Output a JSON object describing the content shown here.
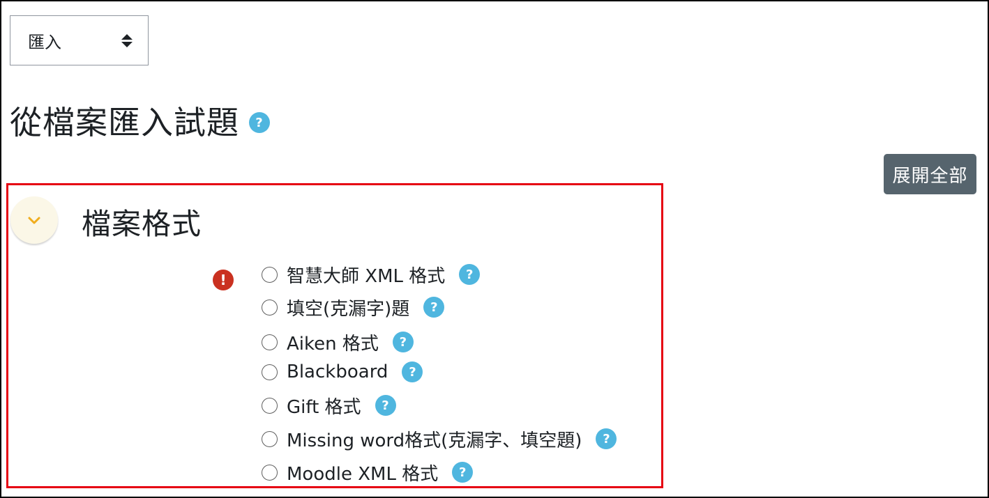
{
  "action_select": {
    "value": "匯入"
  },
  "page": {
    "title": "從檔案匯入試題"
  },
  "toolbar": {
    "expand_all_label": "展開全部"
  },
  "section": {
    "title": "檔案格式",
    "error_icon": "!",
    "options": [
      {
        "label": "智慧大師 XML 格式"
      },
      {
        "label": "填空(克漏字)題"
      },
      {
        "label": "Aiken 格式"
      },
      {
        "label": "Blackboard"
      },
      {
        "label": "Gift 格式"
      },
      {
        "label": "Missing word格式(克漏字、填空題)"
      },
      {
        "label": "Moodle XML 格式"
      }
    ]
  },
  "help_icon_glyph": "?",
  "colors": {
    "help": "#4fb6df",
    "error": "#ca3120",
    "accent_toggle": "#f0ad1e",
    "highlight_box": "#e60012",
    "button": "#56646d"
  },
  "icons": {
    "help": "question-circle-icon",
    "error": "exclamation-circle-icon",
    "toggle": "chevron-down-icon"
  }
}
